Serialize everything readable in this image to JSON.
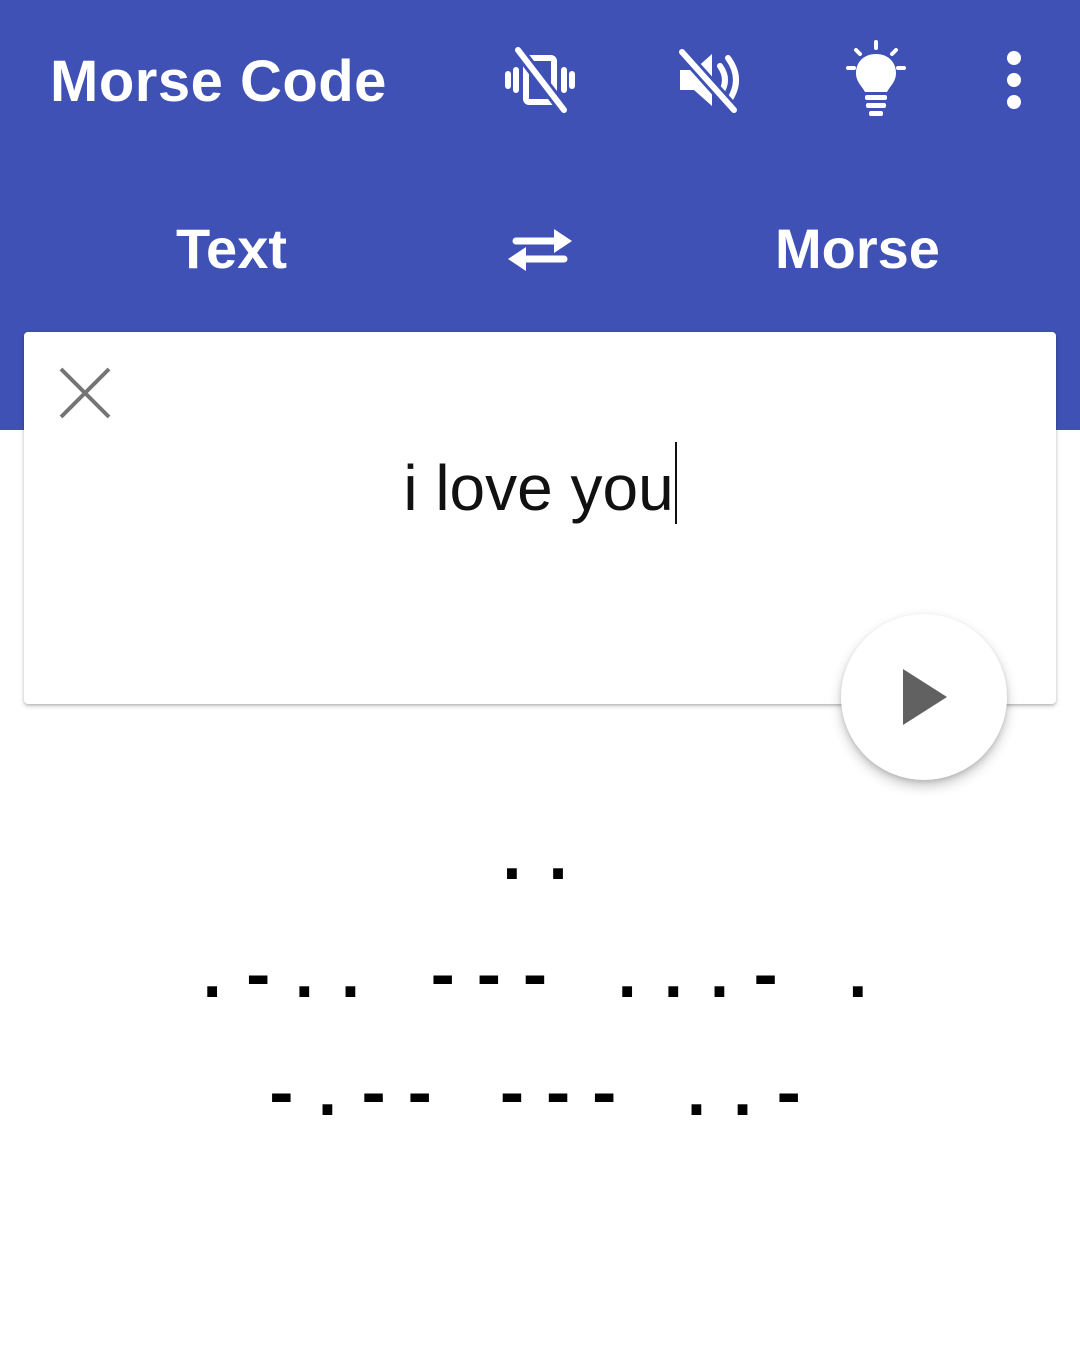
{
  "appbar": {
    "title": "Morse Code",
    "actions": [
      {
        "name": "vibration-off-icon"
      },
      {
        "name": "volume-off-icon"
      },
      {
        "name": "flashlight-icon"
      },
      {
        "name": "more-vert-icon"
      }
    ],
    "color": "#3F51B5"
  },
  "tabs": {
    "left_label": "Text",
    "right_label": "Morse",
    "swap_icon": "swap-arrows-icon"
  },
  "input": {
    "value": "i love you",
    "clear_icon": "close-icon"
  },
  "play_button": {
    "icon": "play-icon"
  },
  "output": {
    "lines": [
      "..",
      ".-.. --- ...- .",
      "-.-- --- ..-"
    ]
  }
}
